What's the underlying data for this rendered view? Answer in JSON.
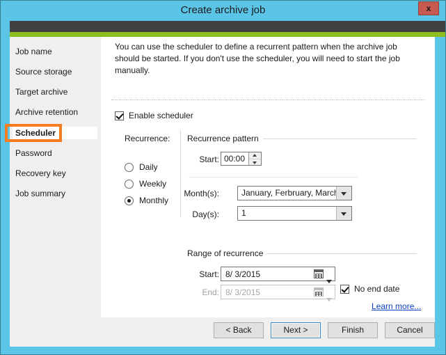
{
  "window": {
    "title": "Create archive job",
    "close_label": "x"
  },
  "sidebar": {
    "items": [
      {
        "label": "Job name",
        "active": false
      },
      {
        "label": "Source storage",
        "active": false
      },
      {
        "label": "Target archive",
        "active": false
      },
      {
        "label": "Archive retention",
        "active": false
      },
      {
        "label": "Scheduler",
        "active": true
      },
      {
        "label": "Password",
        "active": false
      },
      {
        "label": "Recovery key",
        "active": false
      },
      {
        "label": "Job summary",
        "active": false
      }
    ]
  },
  "content": {
    "intro": "You can use the scheduler to define a recurrent pattern when the archive job should be started. If you don't use the scheduler, you will need to start the job manually.",
    "enable_scheduler": {
      "label": "Enable scheduler",
      "checked": true
    },
    "recurrence": {
      "label": "Recurrence:",
      "options": [
        {
          "label": "Daily",
          "selected": false
        },
        {
          "label": "Weekly",
          "selected": false
        },
        {
          "label": "Monthly",
          "selected": true
        }
      ]
    },
    "recurrence_pattern": {
      "title": "Recurrence pattern",
      "start_time_label": "Start:",
      "start_time_value": "00:00",
      "months_label": "Month(s):",
      "months_value": "January, Ferbruary, March,...",
      "days_label": "Day(s):",
      "days_value": "1"
    },
    "range_of_recurrence": {
      "title": "Range of recurrence",
      "start_label": "Start:",
      "start_value": "8/  3/2015",
      "end_label": "End:",
      "end_value": "8/  3/2015",
      "end_disabled": true,
      "no_end_date": {
        "label": "No end date",
        "checked": true
      }
    },
    "learn_more": "Learn more..."
  },
  "footer": {
    "back": "< Back",
    "next": "Next >",
    "finish": "Finish",
    "cancel": "Cancel"
  },
  "colors": {
    "window_accent": "#5bc5e8",
    "banner_dark": "#414141",
    "banner_green": "#8cbe22",
    "annotation": "#f57c1f",
    "link": "#0b42c0",
    "close_button": "#c75b4f"
  }
}
